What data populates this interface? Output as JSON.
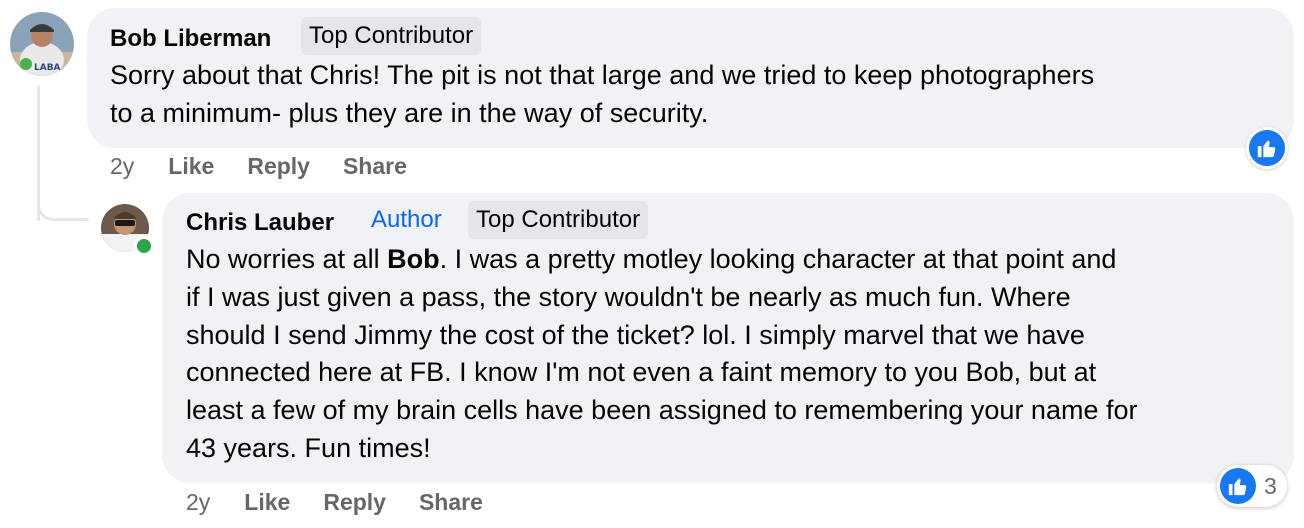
{
  "comments": [
    {
      "author": "Bob Liberman",
      "badges": [
        "Top Contributor"
      ],
      "lines": [
        "Sorry about that Chris! The pit is not that large and we tried to keep photographers",
        "to a minimum- plus they are in the way of security."
      ],
      "time": "2y",
      "actions": [
        "Like",
        "Reply",
        "Share"
      ],
      "reaction": {
        "icon": "like-icon"
      }
    },
    {
      "author": "Chris Lauber",
      "author_tag": "Author",
      "badges": [
        "Top Contributor"
      ],
      "lines_pre_bold": "No worries at all ",
      "bold_name": "Bob",
      "lines_post_bold": ". I was a pretty motley looking character at that point and",
      "lines": [
        "if I was just given a pass, the story wouldn't be nearly as much fun. Where",
        "should I send Jimmy the cost of the ticket? lol. I simply marvel that we have",
        "connected here at FB. I know I'm not even a faint memory to you Bob, but at",
        "least a few of my brain cells have been assigned to remembering your name for",
        "43 years. Fun times!"
      ],
      "time": "2y",
      "actions": [
        "Like",
        "Reply",
        "Share"
      ],
      "reaction": {
        "icon": "like-icon",
        "count": "3"
      },
      "online": true
    }
  ],
  "colors": {
    "bubble": "#f0f2f5",
    "accent": "#0866ff",
    "like": "#1877f2",
    "online": "#31a24c"
  }
}
